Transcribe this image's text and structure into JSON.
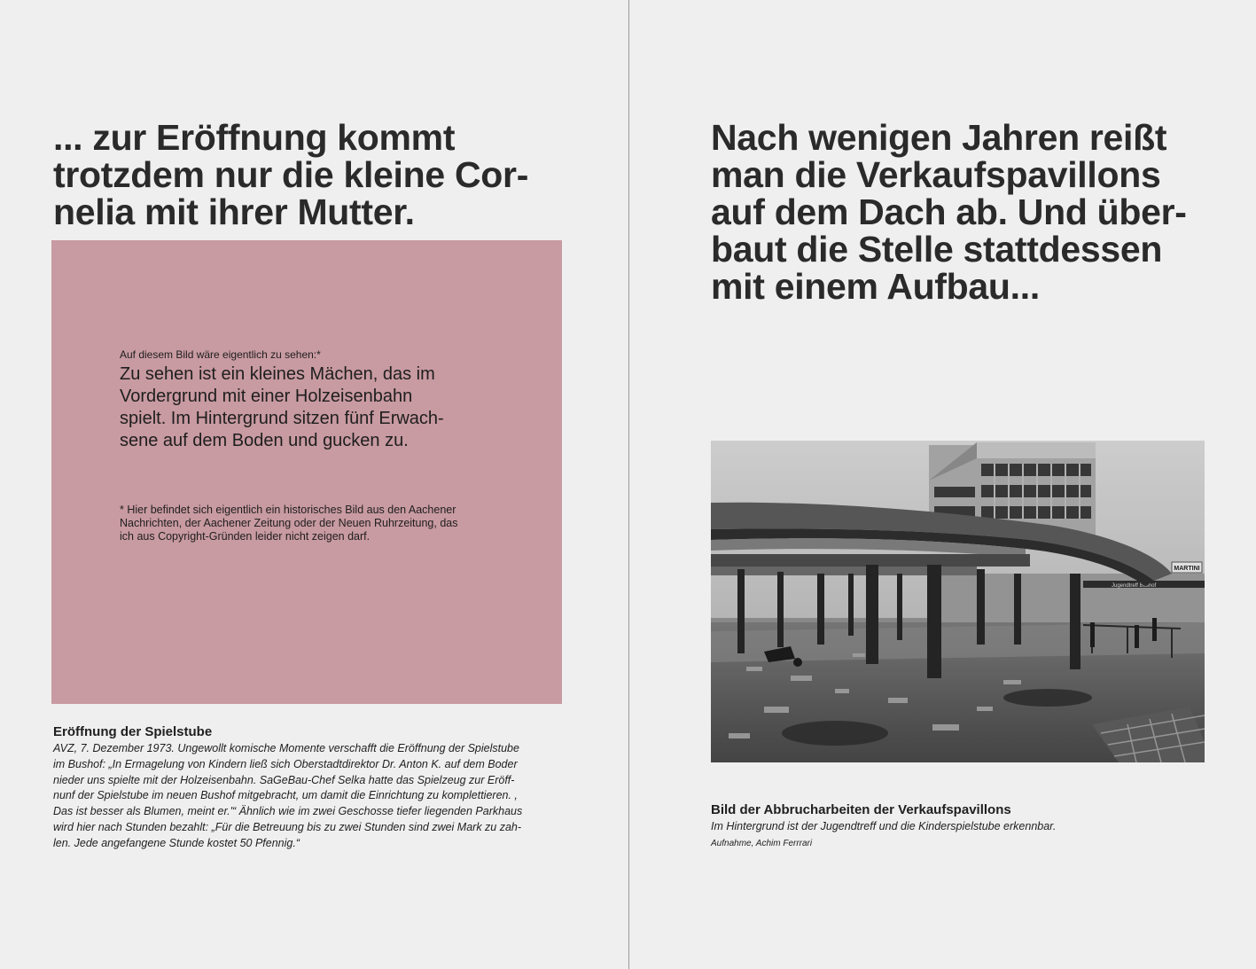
{
  "left_page": {
    "headline": "... zur Eröffnung kommt\ntrotzdem nur die kleine Cor-\nnelia mit ihrer Mutter.",
    "placeholder": {
      "label": "Auf diesem Bild wäre eigentlich zu sehen:*",
      "description": "Zu sehen ist ein kleines Mächen, das im\nVordergrund mit einer Holzeisenbahn\nspielt. Im Hintergrund sitzen fünf Erwach-\nsene auf dem Boden und gucken zu.",
      "footnote": "* Hier befindet sich eigentlich ein historisches Bild aus den Aachener\nNachrichten, der Aachener Zeitung oder der Neuen Ruhrzeitung, das\nich aus Copyright-Gründen leider nicht zeigen darf.",
      "color": "#c89aa1"
    },
    "caption": {
      "title": "Eröffnung der Spielstube",
      "body": "AVZ, 7. Dezember 1973. Ungewollt komische Momente verschafft die Eröffnung der Spielstube\nim Bushof: „In Ermagelung von Kindern ließ sich Oberstadtdirektor Dr. Anton K. auf dem Boder\nnieder uns spielte mit der Holzeisenbahn. SaGeBau-Chef Selka hatte das Spielzeug zur Eröff-\nnunf der Spielstube im neuen Bushof mitgebracht, um damit die Einrichtung zu komplettieren. ,\nDas ist besser als Blumen, meint er.'“ Ähnlich wie im zwei Geschosse tiefer liegenden Parkhaus\nwird hier nach Stunden bezahlt: „Für die Betreuung bis zu zwei Stunden sind zwei Mark zu zah-\nlen. Jede angefangene Stunde kostet 50 Pfennig.“"
    }
  },
  "right_page": {
    "headline": "Nach wenigen Jahren reißt\nman die Verkaufspavillons\nauf dem Dach ab. Und über-\nbaut die Stelle stattdessen\nmit einem Aufbau...",
    "photo": {
      "sign_text": "MARTINI"
    },
    "caption": {
      "title": "Bild der Abbrucharbeiten der Verkaufspavillons",
      "body": "Im Hintergrund ist der Jugendtreff und die Kinderspielstube erkennbar.",
      "credit": "Aufnahme, Achim Ferrrari"
    }
  }
}
